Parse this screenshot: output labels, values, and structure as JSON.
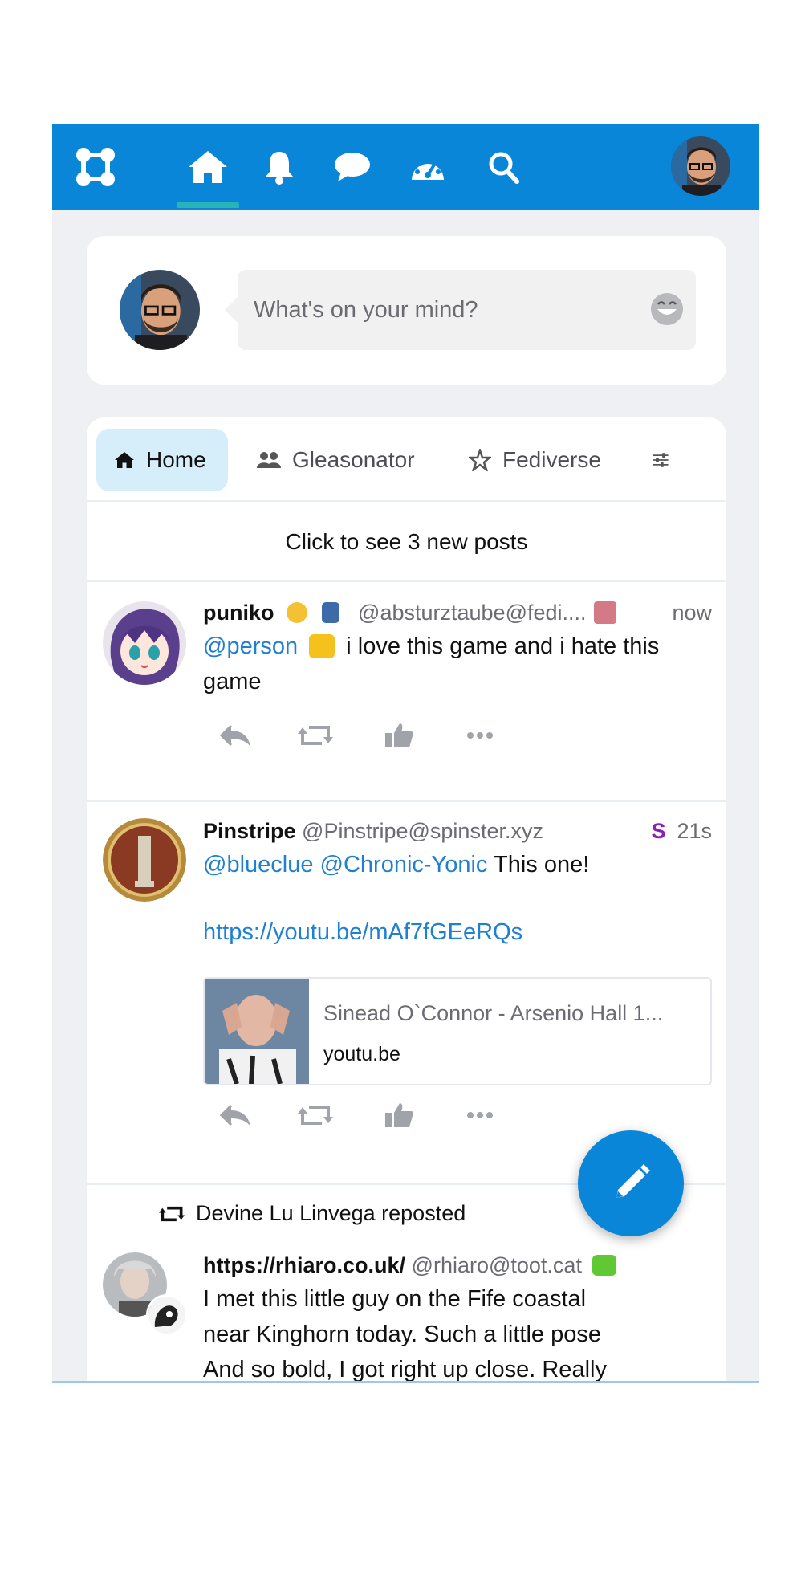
{
  "topbar": {
    "nav": [
      "logo-icon",
      "home-icon",
      "bell-icon",
      "chat-bubble-icon",
      "dashboard-gauge-icon",
      "search-icon"
    ],
    "brand_color": "#0a86d8",
    "active_indicator_color": "#27b3b7"
  },
  "compose": {
    "placeholder": "What's on your mind?"
  },
  "tabs": [
    {
      "label": "Home",
      "icon": "home-icon",
      "active": true
    },
    {
      "label": "Gleasonator",
      "icon": "users-icon",
      "active": false
    },
    {
      "label": "Fediverse",
      "icon": "fediverse-star-icon",
      "active": false
    }
  ],
  "new_posts": "Click to see 3 new posts",
  "posts": [
    {
      "name": "puniko",
      "handle": "@absturztaube@fedi....",
      "time": "now",
      "mention": "@person",
      "text": "i love this game and i hate this game"
    },
    {
      "name": "Pinstripe",
      "handle": "@Pinstripe@spinster.xyz",
      "badge": "S",
      "time": "21s",
      "mention1": "@blueclue",
      "mention2": "@Chronic-Yonic",
      "text": "This one!",
      "link": "https://youtu.be/mAf7fGEeRQs",
      "card_title": "Sinead O`Connor - Arsenio Hall 1...",
      "card_domain": "youtu.be"
    },
    {
      "repost_by": "Devine Lu Linvega reposted",
      "name": "https://rhiaro.co.uk/",
      "handle": "@rhiaro@toot.cat",
      "text_line1": "I met this little guy on the Fife coastal",
      "text_line2": "near Kinghorn today. Such a little pose",
      "text_line3": "And so bold, I got right up close. Really"
    }
  ],
  "colors": {
    "link": "#1f7fd0",
    "badge": "#8a1fb0"
  }
}
